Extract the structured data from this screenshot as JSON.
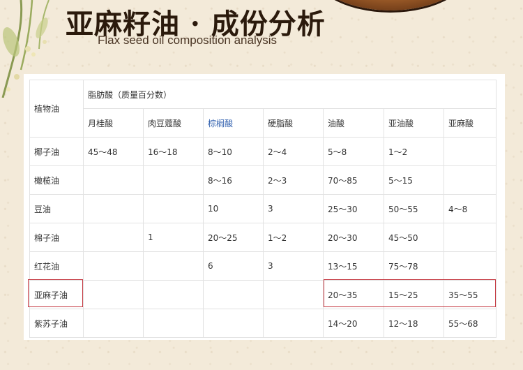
{
  "header": {
    "title": "亚麻籽油 · 成份分析",
    "subtitle": "Flax seed oil composition analysis"
  },
  "table": {
    "oil_header": "植物油",
    "group_header": "脂肪酸（质量百分数）",
    "columns": [
      "月桂酸",
      "肉豆蔻酸",
      "棕榈酸",
      "硬脂酸",
      "油酸",
      "亚油酸",
      "亚麻酸"
    ],
    "rows": [
      {
        "oil": "椰子油",
        "values": [
          "45～48",
          "16～18",
          "8～10",
          "2～4",
          "5～8",
          "1～2",
          ""
        ]
      },
      {
        "oil": "橄榄油",
        "values": [
          "",
          "",
          "8～16",
          "2～3",
          "70～85",
          "5～15",
          ""
        ]
      },
      {
        "oil": "豆油",
        "values": [
          "",
          "",
          "10",
          "3",
          "25～30",
          "50～55",
          "4～8"
        ]
      },
      {
        "oil": "棉子油",
        "values": [
          "",
          "1",
          "20～25",
          "1～2",
          "20～30",
          "45～50",
          ""
        ]
      },
      {
        "oil": "红花油",
        "values": [
          "",
          "",
          "6",
          "3",
          "13～15",
          "75～78",
          ""
        ]
      },
      {
        "oil": "亚麻子油",
        "values": [
          "",
          "",
          "",
          "",
          "20～35",
          "15～25",
          "35～55"
        ]
      },
      {
        "oil": "紫苏子油",
        "values": [
          "",
          "",
          "",
          "",
          "14～20",
          "12～18",
          "55～68"
        ]
      }
    ]
  },
  "colors": {
    "highlight": "#c4363f",
    "link_blue": "#2f5fae"
  }
}
